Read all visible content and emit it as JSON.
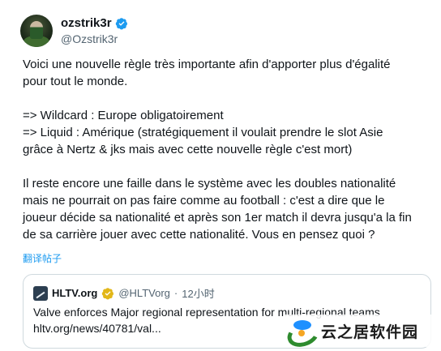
{
  "author": {
    "display_name": "ozstrik3r",
    "handle": "@Ozstrik3r"
  },
  "tweet": {
    "line1": "Voici une nouvelle règle très importante afin d'apporter plus d'égalité",
    "line2": "pour tout le monde.",
    "line3": "=> Wildcard : Europe obligatoirement",
    "line4": "=> Liquid : Amérique (stratégiquement il voulait prendre le slot Asie",
    "line5": "grâce à Nertz & jks mais avec cette nouvelle règle c'est mort)",
    "line6": "Il reste encore une faille dans le système avec les doubles nationalité",
    "line7": "mais ne pourrait on pas faire comme au football : c'est a dire que le",
    "line8": "joueur décide sa nationalité et après son 1er match il devra jusqu'a la fin",
    "line9": "de sa carrière jouer avec cette nationalité. Vous en pensez quoi ?"
  },
  "translate_label": "翻译帖子",
  "quote": {
    "name": "HLTV.org",
    "handle": "@HLTVorg",
    "dot": "·",
    "time": "12小时",
    "text": "Valve enforces Major regional representation for multi-regional teams",
    "link": "hltv.org/news/40781/val..."
  },
  "watermark": {
    "text": "云之居软件园"
  },
  "colors": {
    "verified": "#1d9bf0",
    "link": "#1d9bf0",
    "secondary_text": "#536471",
    "border": "#cfd9de"
  }
}
